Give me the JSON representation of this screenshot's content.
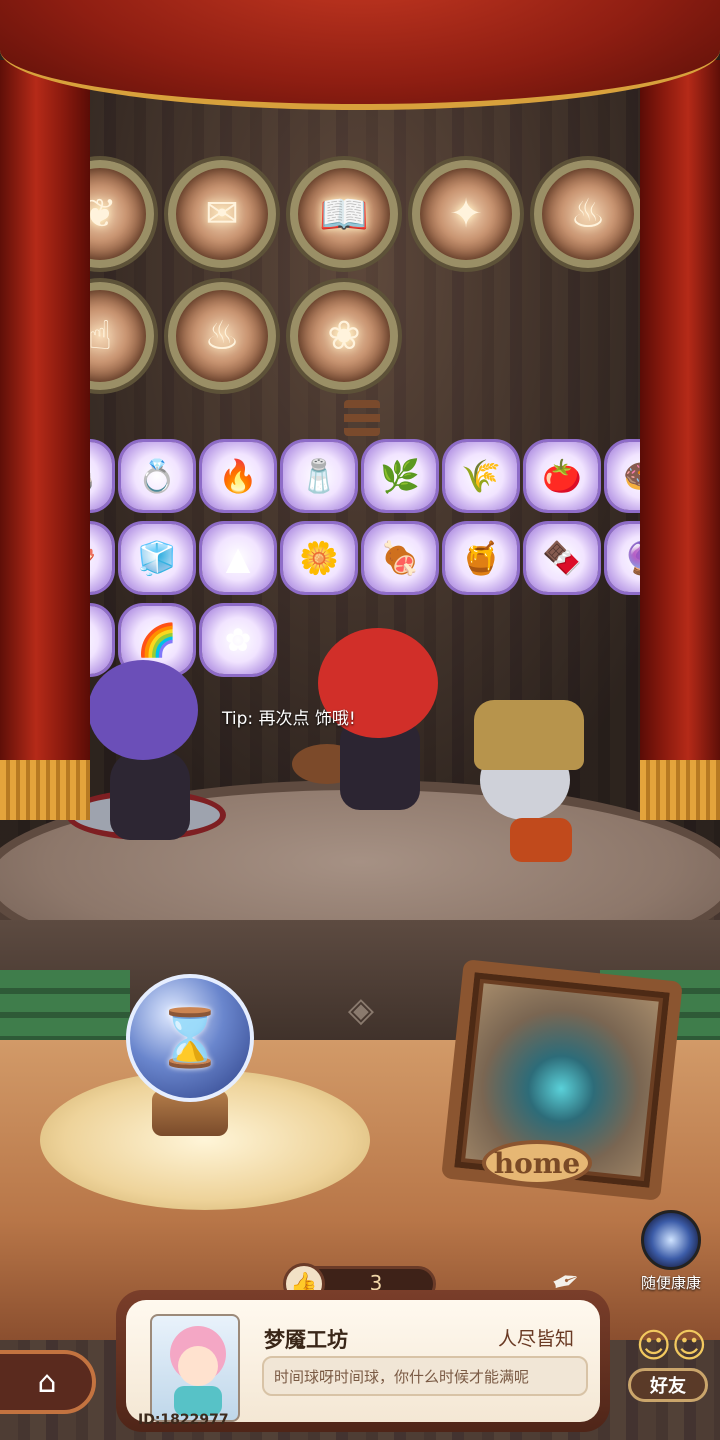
{
  "badges": [
    {
      "icon": "❦"
    },
    {
      "icon": "✉"
    },
    {
      "icon": "📖"
    },
    {
      "icon": "✦"
    },
    {
      "icon": "♨"
    },
    {
      "icon": "☝"
    },
    {
      "icon": "♨"
    },
    {
      "icon": "❀"
    }
  ],
  "items": [
    {
      "icon": "🪨"
    },
    {
      "icon": "💍"
    },
    {
      "icon": "🔥"
    },
    {
      "icon": "🧂"
    },
    {
      "icon": "🌿"
    },
    {
      "icon": "🌾"
    },
    {
      "icon": "🍅"
    },
    {
      "icon": "🍩"
    },
    {
      "icon": "🪸"
    },
    {
      "icon": "🧊"
    },
    {
      "icon": "▲"
    },
    {
      "icon": "🌼"
    },
    {
      "icon": "🍖"
    },
    {
      "icon": "🍯"
    },
    {
      "icon": "🍫"
    },
    {
      "icon": "🔮"
    },
    {
      "icon": "◆"
    },
    {
      "icon": "🌈"
    },
    {
      "icon": "✿"
    }
  ],
  "tip": {
    "text": "Tip: 再次点 饰哦!"
  },
  "crystal": {
    "icon": "⌛"
  },
  "home_frame": {
    "label": "home"
  },
  "portal": {
    "label": "随便康康"
  },
  "friends": {
    "label": "好友"
  },
  "likes": {
    "count": "3",
    "icon": "👍"
  },
  "profile": {
    "name": "梦魇工坊",
    "title": "人尽皆知",
    "signature": "时间球呀时间球，你什么时候才能满呢",
    "id": "ID:1822977"
  },
  "nav": {
    "home_icon": "⌂"
  }
}
